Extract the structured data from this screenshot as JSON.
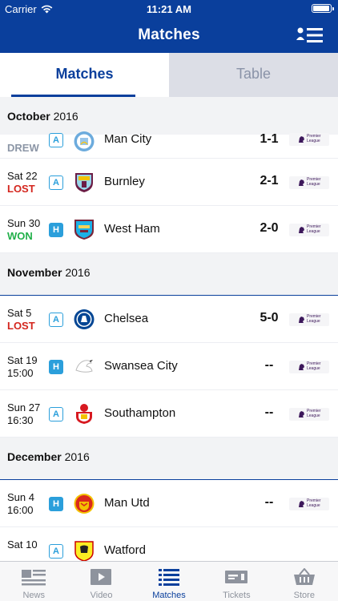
{
  "status": {
    "carrier": "Carrier",
    "time": "11:21 AM",
    "battery_level": 1.0
  },
  "header": {
    "title": "Matches"
  },
  "segments": [
    {
      "label": "Matches",
      "active": true
    },
    {
      "label": "Table",
      "active": false
    }
  ],
  "months": [
    {
      "month": "October",
      "year": "2016"
    },
    {
      "month": "November",
      "year": "2016"
    },
    {
      "month": "December",
      "year": "2016"
    }
  ],
  "matches": [
    {
      "day": "",
      "result": "DREW",
      "ha": "A",
      "team": "Man City",
      "score": "1-1",
      "crest": "man-city-crest"
    },
    {
      "day": "Sat 22",
      "result": "LOST",
      "ha": "A",
      "team": "Burnley",
      "score": "2-1",
      "crest": "burnley-crest"
    },
    {
      "day": "Sun 30",
      "result": "WON",
      "ha": "H",
      "team": "West Ham",
      "score": "2-0",
      "crest": "west-ham-crest"
    },
    {
      "day": "Sat 5",
      "result": "LOST",
      "ha": "A",
      "team": "Chelsea",
      "score": "5-0",
      "crest": "chelsea-crest"
    },
    {
      "day": "Sat 19",
      "result": "15:00",
      "ha": "H",
      "team": "Swansea City",
      "score": "--",
      "crest": "swansea-crest"
    },
    {
      "day": "Sun 27",
      "result": "16:30",
      "ha": "A",
      "team": "Southampton",
      "score": "--",
      "crest": "southampton-crest"
    },
    {
      "day": "Sun 4",
      "result": "16:00",
      "ha": "H",
      "team": "Man Utd",
      "score": "--",
      "crest": "man-utd-crest"
    },
    {
      "day": "Sat 10",
      "result": "",
      "ha": "A",
      "team": "Watford",
      "score": "",
      "crest": "watford-crest"
    }
  ],
  "competition_badge": {
    "line1": "Premier",
    "line2": "League"
  },
  "tabs": [
    {
      "label": "News",
      "icon": "news-icon"
    },
    {
      "label": "Video",
      "icon": "video-icon"
    },
    {
      "label": "Matches",
      "icon": "matches-list-icon",
      "active": true
    },
    {
      "label": "Tickets",
      "icon": "ticket-icon"
    },
    {
      "label": "Store",
      "icon": "basket-icon"
    }
  ],
  "colors": {
    "brand": "#0a3f9c",
    "won": "#22b04a",
    "lost": "#d4261e",
    "drew": "#8c96a6",
    "home_away": "#2b9fdb"
  }
}
